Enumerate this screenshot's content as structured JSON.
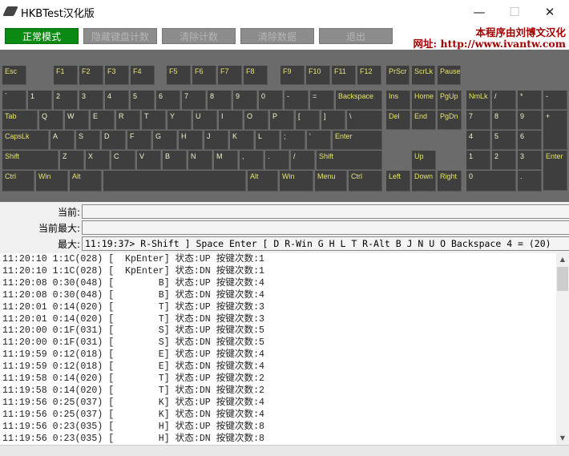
{
  "window": {
    "title": "HKBTest汉化版",
    "minimize": "—",
    "maximize": "☐",
    "close": "✕"
  },
  "toolbar": {
    "buttons": [
      "正常模式",
      "隐藏键盘计数",
      "清除计数",
      "清除数据",
      "退出"
    ],
    "active_color": "#0a8a12"
  },
  "credit": {
    "line1": "本程序由刘博文汉化",
    "line2": "网址: http://www.ivantw.com",
    "color": "#a00000"
  },
  "keyboard": {
    "keys": [
      "Esc",
      "F1",
      "F2",
      "F3",
      "F4",
      "F5",
      "F6",
      "F7",
      "F8",
      "F9",
      "F10",
      "F11",
      "F12",
      "PrScr",
      "ScrLk",
      "Pause",
      "`",
      "1",
      "2",
      "3",
      "4",
      "5",
      "6",
      "7",
      "8",
      "9",
      "0",
      "-",
      "=",
      "Backspace",
      "Ins",
      "Home",
      "PgUp",
      "NmLk",
      "/",
      "*",
      "-",
      "Tab",
      "Q",
      "W",
      "E",
      "R",
      "T",
      "Y",
      "U",
      "I",
      "O",
      "P",
      "[",
      "]",
      "\\",
      "Del",
      "End",
      "PgDn",
      "7",
      "8",
      "9",
      "+",
      "CapsLk",
      "A",
      "S",
      "D",
      "F",
      "G",
      "H",
      "J",
      "K",
      "L",
      ";",
      "'",
      "Enter",
      "4",
      "5",
      "6",
      "Shift",
      "Z",
      "X",
      "C",
      "V",
      "B",
      "N",
      "M",
      ",",
      ".",
      "/",
      "Shift",
      "Up",
      "1",
      "2",
      "3",
      "Enter",
      "Ctrl",
      "Win",
      "Alt",
      "",
      "Alt",
      "Win",
      "Menu",
      "Ctrl",
      "Left",
      "Down",
      "Right",
      "0",
      "."
    ]
  },
  "fields": {
    "current_label": "当前:",
    "current_value": "",
    "current_max_label": "当前最大:",
    "current_max_value": "",
    "max_label": "最大:",
    "max_value": "11:19:37> R-Shift ] Space Enter [ D R-Win G H L T R-Alt B J N U O Backspace 4 = (20)"
  },
  "log": [
    "11:20:10 1:1C(028) [  KpEnter] 状态:UP 按键次数:1",
    "11:20:10 1:1C(028) [  KpEnter] 状态:DN 按键次数:1",
    "11:20:08 0:30(048) [        B] 状态:UP 按键次数:4",
    "11:20:08 0:30(048) [        B] 状态:DN 按键次数:4",
    "11:20:01 0:14(020) [        T] 状态:UP 按键次数:3",
    "11:20:01 0:14(020) [        T] 状态:DN 按键次数:3",
    "11:20:00 0:1F(031) [        S] 状态:UP 按键次数:5",
    "11:20:00 0:1F(031) [        S] 状态:DN 按键次数:5",
    "11:19:59 0:12(018) [        E] 状态:UP 按键次数:4",
    "11:19:59 0:12(018) [        E] 状态:DN 按键次数:4",
    "11:19:58 0:14(020) [        T] 状态:UP 按键次数:2",
    "11:19:58 0:14(020) [        T] 状态:DN 按键次数:2",
    "11:19:56 0:25(037) [        K] 状态:UP 按键次数:4",
    "11:19:56 0:25(037) [        K] 状态:DN 按键次数:4",
    "11:19:56 0:23(035) [        H] 状态:UP 按键次数:8",
    "11:19:56 0:23(035) [        H] 状态:DN 按键次数:8"
  ]
}
